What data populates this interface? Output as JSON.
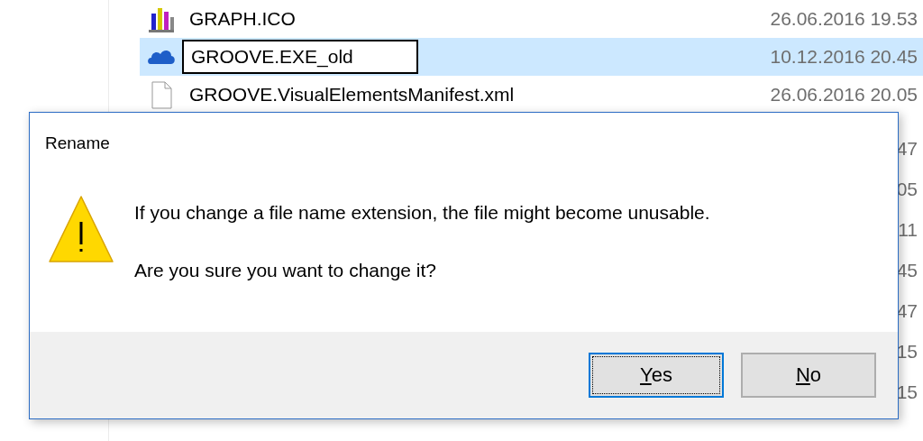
{
  "file_list": {
    "rows": [
      {
        "kind": "chart",
        "name": "GRAPH.ICO",
        "modified": "26.06.2016 19.53",
        "selected": false,
        "editing": false
      },
      {
        "kind": "cloud",
        "name": "GROOVE.EXE_old",
        "modified": "10.12.2016 20.45",
        "selected": true,
        "editing": true
      },
      {
        "kind": "document",
        "name": "GROOVE.VisualElementsManifest.xml",
        "modified": "26.06.2016 20.05",
        "selected": false,
        "editing": false
      },
      {
        "kind": "hidden",
        "modified": "47"
      },
      {
        "kind": "hidden",
        "modified": "05"
      },
      {
        "kind": "hidden",
        "modified": "11"
      },
      {
        "kind": "hidden",
        "modified": "45"
      },
      {
        "kind": "hidden",
        "modified": "47"
      },
      {
        "kind": "hidden",
        "modified": "15"
      },
      {
        "kind": "hidden",
        "modified": "15"
      }
    ]
  },
  "dialog": {
    "title": "Rename",
    "message": "If you change a file name extension, the file might become unusable.",
    "question": "Are you sure you want to change it?",
    "buttons": [
      {
        "label": "Yes",
        "default": true
      },
      {
        "label": "No",
        "default": false
      }
    ]
  }
}
